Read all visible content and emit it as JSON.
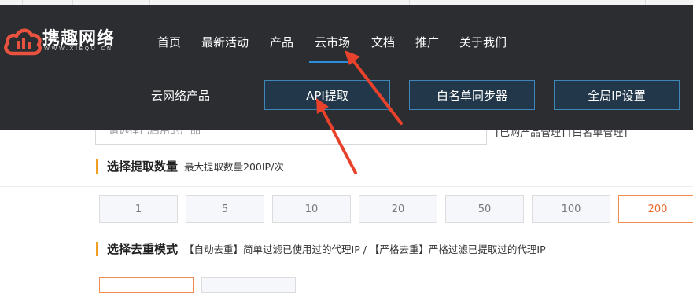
{
  "brand": {
    "name": "携趣网络",
    "domain": "WWW.XIEQU.CN"
  },
  "nav": {
    "items": [
      "首页",
      "最新活动",
      "产品",
      "云市场",
      "文档",
      "推广",
      "关于我们"
    ],
    "active": "云市场"
  },
  "submenu": {
    "label": "云网络产品",
    "buttons": [
      "API提取",
      "白名单同步器",
      "全局IP设置"
    ]
  },
  "product": {
    "placeholder": "请选择已启用的产品",
    "links": "[已购产品管理] [白名单管理]"
  },
  "quantity": {
    "title": "选择提取数量",
    "hint": "最大提取数量200IP/次",
    "options": [
      "1",
      "5",
      "10",
      "20",
      "50",
      "100",
      "200"
    ],
    "selected": "200"
  },
  "dedupe": {
    "title": "选择去重模式",
    "hint": "【自动去重】简单过滤已使用过的代理IP  /  【严格去重】严格过滤已提取过的代理IP"
  },
  "colors": {
    "overlay_bg": "#2b2d30",
    "accent": "#f08c50",
    "arrow": "#e8412c",
    "nav_underline": "#2a8ddc"
  }
}
